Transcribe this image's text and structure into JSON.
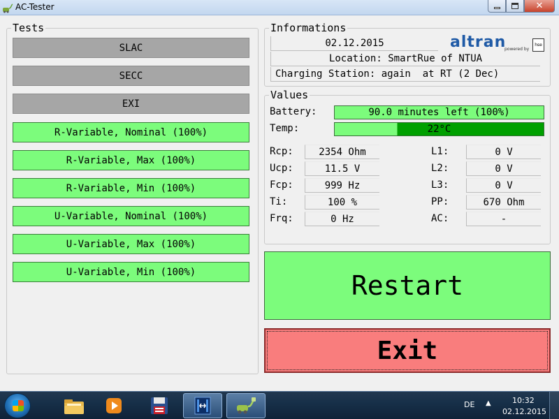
{
  "window": {
    "title": "AC-Tester"
  },
  "tests": {
    "legend": "Tests",
    "buttons": [
      {
        "label": "SLAC",
        "state": "gray"
      },
      {
        "label": "SECC",
        "state": "gray"
      },
      {
        "label": "EXI",
        "state": "gray"
      },
      {
        "label": "R-Variable, Nominal (100%)",
        "state": "green"
      },
      {
        "label": "R-Variable, Max (100%)",
        "state": "green"
      },
      {
        "label": "R-Variable, Min (100%)",
        "state": "green"
      },
      {
        "label": "U-Variable, Nominal (100%)",
        "state": "green"
      },
      {
        "label": "U-Variable, Max (100%)",
        "state": "green"
      },
      {
        "label": "U-Variable, Min (100%)",
        "state": "green"
      }
    ]
  },
  "informations": {
    "legend": "Informations",
    "date": "02.12.2015",
    "location": "Location: SmartRue of NTUA",
    "station": "Charging Station: again  at RT (2 Dec)",
    "logo_text": "altran",
    "logo_sub": "powered by",
    "logo_badge": "hse"
  },
  "values": {
    "legend": "Values",
    "battery": {
      "label": "Battery:",
      "text": "90.0 minutes left (100%)",
      "fill_fraction": 1.0
    },
    "temp": {
      "label": "Temp:",
      "text": "22°C",
      "fill_fraction": 0.7
    },
    "left": [
      {
        "label": "Rcp:",
        "value": "2354 Ohm"
      },
      {
        "label": "Ucp:",
        "value": "11.5 V"
      },
      {
        "label": "Fcp:",
        "value": "999 Hz"
      },
      {
        "label": "Ti:",
        "value": "100 %"
      },
      {
        "label": "Frq:",
        "value": "0 Hz"
      }
    ],
    "right": [
      {
        "label": "L1:",
        "value": "0 V"
      },
      {
        "label": "L2:",
        "value": "0 V"
      },
      {
        "label": "L3:",
        "value": "0 V"
      },
      {
        "label": "PP:",
        "value": "670 Ohm"
      },
      {
        "label": "AC:",
        "value": "-"
      }
    ]
  },
  "actions": {
    "restart_label": "Restart",
    "exit_label": "Exit"
  },
  "taskbar": {
    "language": "DE",
    "time": "10:32",
    "date": "02.12.2015"
  },
  "colors": {
    "button_green": "#7cfc7c",
    "button_gray": "#a6a6a6",
    "exit_red": "#f97d7d",
    "temp_dark_green": "#00a000"
  },
  "icons": [
    "start-orb-icon",
    "folder-icon",
    "media-player-icon",
    "save-disk-icon",
    "app-window-icon",
    "ac-tester-plug-icon"
  ]
}
